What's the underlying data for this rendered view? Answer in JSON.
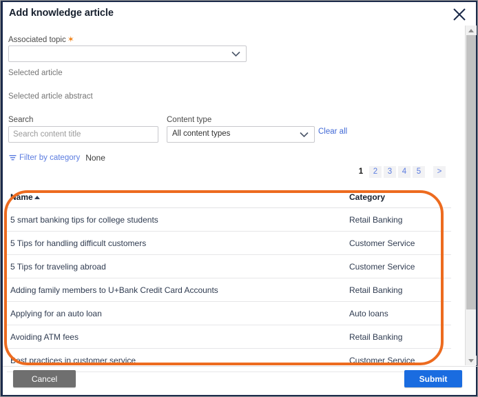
{
  "dialog": {
    "title": "Add knowledge article",
    "close_icon": "close-icon"
  },
  "form": {
    "topic_label": "Associated topic",
    "topic_required_marker": "✶",
    "topic_value": "",
    "selected_article_label": "Selected article",
    "selected_article_abstract_label": "Selected article abstract",
    "search_label": "Search",
    "search_value": "",
    "search_placeholder": "Search content title",
    "content_type_label": "Content type",
    "content_type_value": "All content types",
    "clear_all_label": "Clear all"
  },
  "filter": {
    "icon": "funnel-icon",
    "link_label": "Filter by category",
    "value": "None"
  },
  "pagination": {
    "pages": [
      "1",
      "2",
      "3",
      "4",
      "5"
    ],
    "current": "1",
    "next_label": ">"
  },
  "table": {
    "columns": [
      "Name",
      "Category"
    ],
    "sort_column": "Name",
    "sort_direction": "asc",
    "rows": [
      {
        "name": "5 smart banking tips for college students",
        "category": "Retail Banking"
      },
      {
        "name": "5 Tips for handling difficult customers",
        "category": "Customer Service"
      },
      {
        "name": "5 Tips for traveling abroad",
        "category": "Customer Service"
      },
      {
        "name": "Adding family members to U+Bank Credit Card Accounts",
        "category": "Retail Banking"
      },
      {
        "name": "Applying for an auto loan",
        "category": "Auto loans"
      },
      {
        "name": "Avoiding ATM fees",
        "category": "Retail Banking"
      },
      {
        "name": "Best practices in customer service",
        "category": "Customer Service"
      }
    ]
  },
  "footer": {
    "cancel_label": "Cancel",
    "submit_label": "Submit"
  },
  "colors": {
    "annotation": "#ed6b1f",
    "submit": "#1a6ce0",
    "cancel": "#6f6f6f",
    "link": "#5b7ce0",
    "required_star": "#f08015",
    "frame": "#1b2a4a"
  }
}
